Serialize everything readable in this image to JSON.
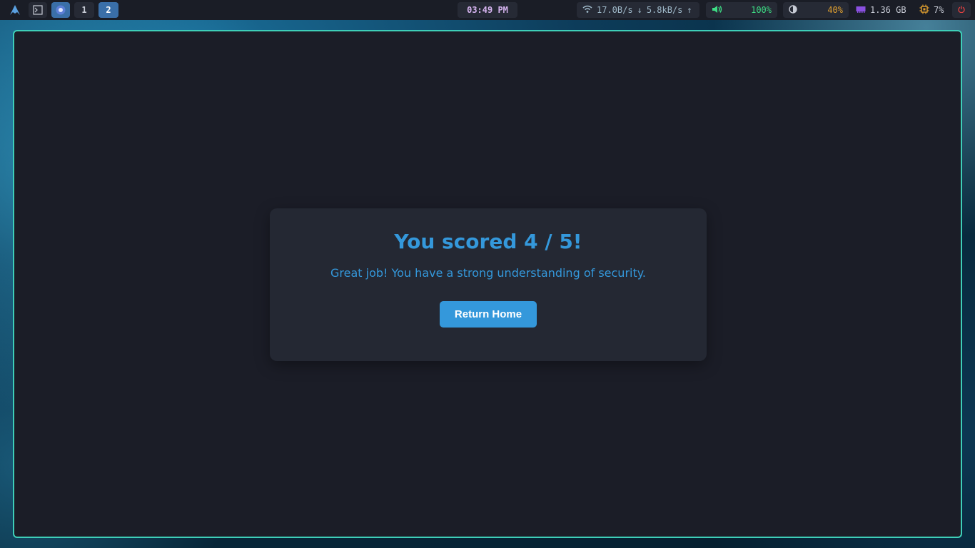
{
  "topbar": {
    "workspaces": [
      "1",
      "2"
    ],
    "active_workspace": "2",
    "clock": "03:49 PM",
    "network": {
      "down": "17.0B/s",
      "up": "5.8kB/s",
      "down_arrow": "↓",
      "up_arrow": "↑"
    },
    "volume": "100%",
    "brightness": "40%",
    "memory": "1.36 GB",
    "cpu": "7%"
  },
  "result": {
    "title": "You scored 4 / 5!",
    "message": "Great job! You have a strong understanding of security.",
    "button_label": "Return Home"
  },
  "colors": {
    "accent": "#3498db",
    "window_border": "#3ecfb8",
    "background": "#1b1d27",
    "card": "#242833"
  }
}
